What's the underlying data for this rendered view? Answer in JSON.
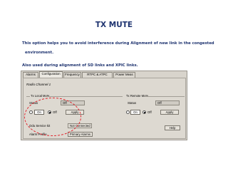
{
  "slide": {
    "title": "TX MUTE",
    "desc_line1": "This option helps you to avoid  interference during Alignment of new link in the congested",
    "desc_line2": "environment.",
    "desc_line3": "Also used during alignment of SD links and XPIC links."
  },
  "tabs": [
    {
      "label": "Alarms"
    },
    {
      "label": "Configuration"
    },
    {
      "label": "Frequency"
    },
    {
      "label": "RTPC & ATPC"
    },
    {
      "label": "Power Meas"
    }
  ],
  "panel": {
    "title": "Radio Channel 1",
    "tx_local": {
      "label": "Tx Local Mute",
      "status_label": "Status",
      "status_value": "Off",
      "on_label": "On",
      "off_label": "Off",
      "selected": "Off",
      "apply_label": "Apply"
    },
    "tx_remote": {
      "label": "Tx Remote Mute",
      "status_label": "Status",
      "status_value": "Off",
      "on_label": "On",
      "off_label": "Off",
      "selected": "Off",
      "apply_label": "Apply"
    },
    "odu_label": "Odu Service kit",
    "odu_value": "Not Connected",
    "alarm_profile_label": "Alarm Profile",
    "alarm_profile_value": "Primary Alarms",
    "help_label": "Help"
  },
  "colors": {
    "title_blue": "#1f3470",
    "annotation_red": "#e0232c",
    "window_bg": "#d8d4cc"
  }
}
